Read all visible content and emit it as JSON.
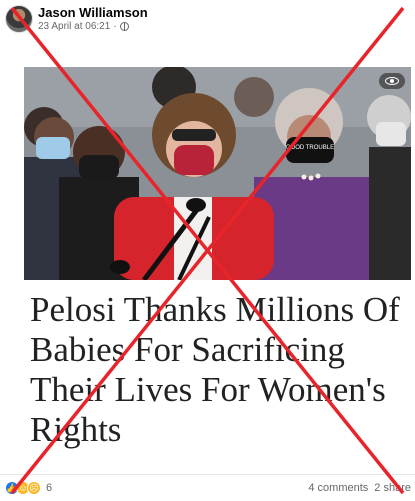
{
  "post": {
    "author": "Jason Williamson",
    "date": "23 April at 06:21",
    "separator": "·",
    "headline_lines": [
      "Pelosi Thanks Millions Of",
      "Babies For Sacrificing",
      "Their Lives For Women's",
      "Rights"
    ],
    "mask_text": "GOOD TROUBLE"
  },
  "footer": {
    "reaction_count": "6",
    "comments": "4 comments",
    "shares": "2 share"
  },
  "colors": {
    "cross": "#e8242b",
    "blazer": "#d5242c",
    "purple": "#6b3a86"
  },
  "icons": [
    "globe-icon",
    "eye-icon",
    "like-reaction-icon",
    "wow-reaction-icon",
    "sad-reaction-icon"
  ]
}
